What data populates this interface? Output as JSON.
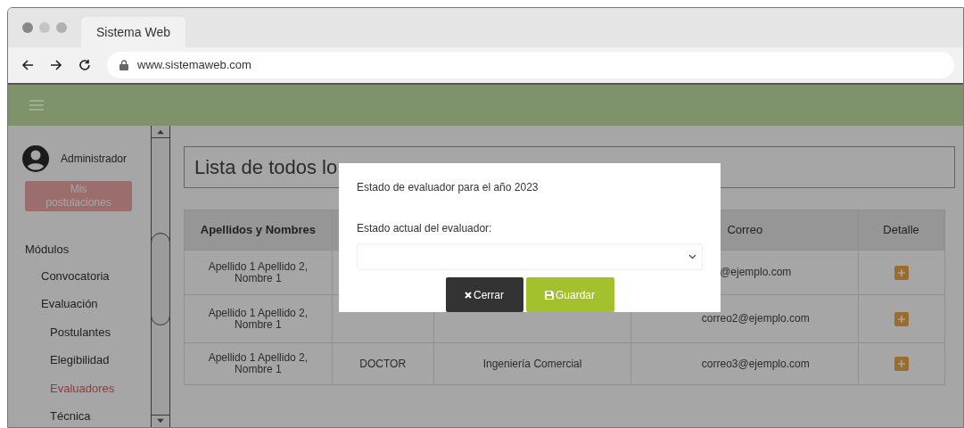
{
  "browser": {
    "tab_title": "Sistema Web",
    "url": "www.sistemaweb.com"
  },
  "sidebar": {
    "user": "Administrador",
    "my_applications_button": "Mis postulaciones",
    "section_title": "Módulos",
    "items": [
      {
        "label": "Convocatoria",
        "selected": false
      },
      {
        "label": "Evaluación",
        "selected": false,
        "children": [
          {
            "label": "Postulantes",
            "selected": false
          },
          {
            "label": "Elegibilidad",
            "selected": false
          },
          {
            "label": "Evaluadores",
            "selected": true
          },
          {
            "label": "Técnica",
            "selected": false
          }
        ]
      }
    ]
  },
  "page_title": "Lista de todos lo",
  "table": {
    "columns": [
      "Apellidos y Nombres",
      null,
      null,
      "Correo",
      "Detalle"
    ],
    "rows": [
      [
        "Apellido 1 Apellido 2, Nombre 1",
        null,
        null,
        "@ejemplo.com"
      ],
      [
        "Apellido 1 Apellido 2, Nombre 1",
        null,
        null,
        "correo2@ejemplo.com"
      ],
      [
        "Apellido 1 Apellido 2, Nombre 1",
        "DOCTOR",
        "Ingeniería Comercial",
        "correo3@ejemplo.com"
      ]
    ]
  },
  "dialog": {
    "title": "Estado de evaluador para el año 2023",
    "field_label": "Estado actual del evaluador:",
    "buttons": [
      {
        "label": "Cerrar",
        "kind": "close"
      },
      {
        "label": "Guardar",
        "kind": "save"
      }
    ]
  }
}
